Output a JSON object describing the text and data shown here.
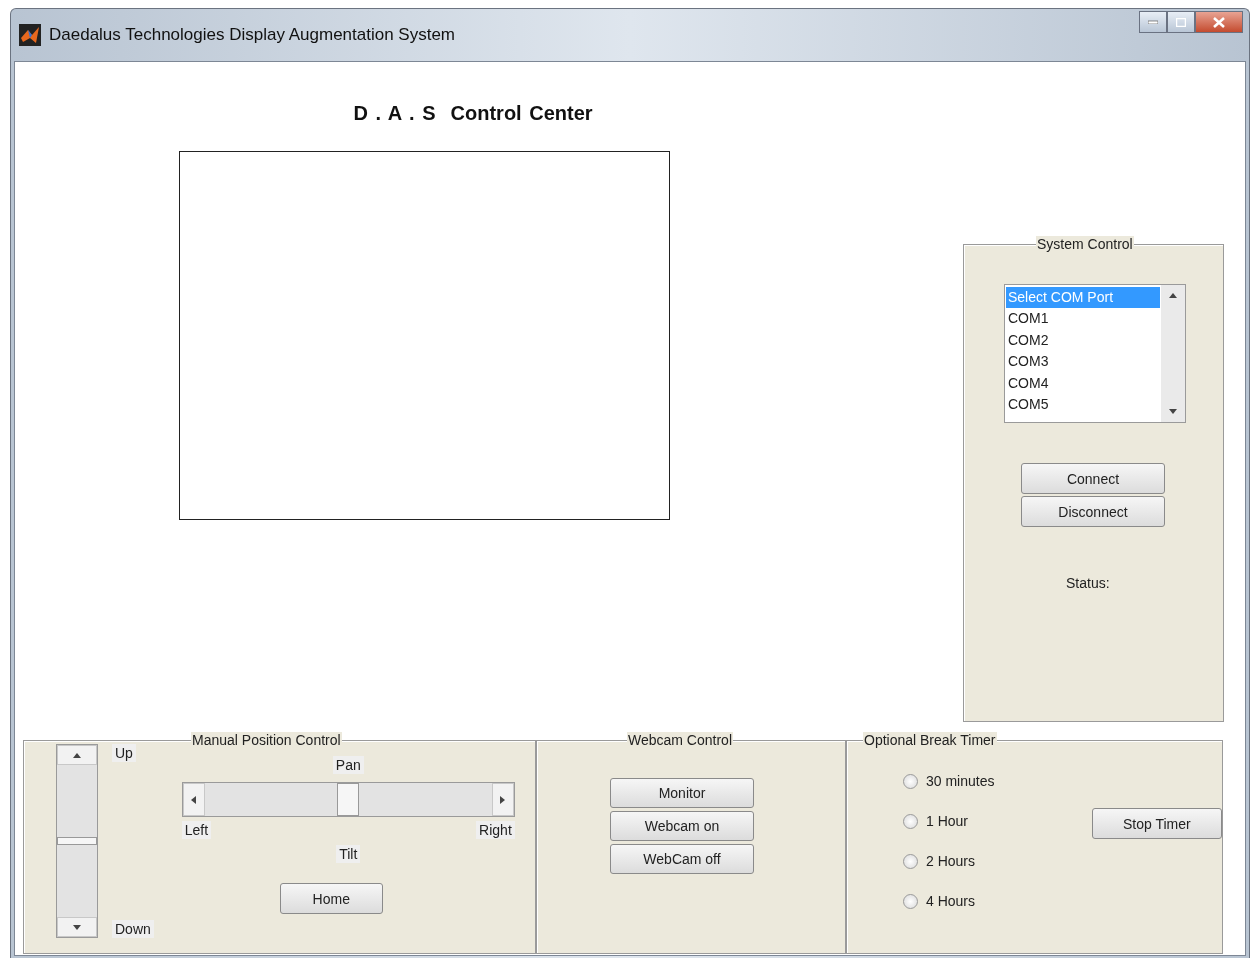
{
  "window": {
    "title": "Daedalus Technologies Display Augmentation System"
  },
  "heading": "D . A . S  Control Center",
  "system_control": {
    "title": "System Control",
    "ports": [
      {
        "label": "Select COM Port",
        "selected": true
      },
      {
        "label": "COM1",
        "selected": false
      },
      {
        "label": "COM2",
        "selected": false
      },
      {
        "label": "COM3",
        "selected": false
      },
      {
        "label": "COM4",
        "selected": false
      },
      {
        "label": "COM5",
        "selected": false
      }
    ],
    "buttons": [
      "Connect",
      "Disconnect"
    ],
    "status_label": "Status:"
  },
  "manual_position_control": {
    "title": "Manual Position Control",
    "up_label": "Up",
    "down_label": "Down",
    "tilt_slider": {
      "level": 0.5
    },
    "pan_label": "Pan",
    "pan_slider": {
      "level": 0.5
    },
    "left_label": "Left",
    "right_label": "Right",
    "tilt_label": "Tilt",
    "home_button": "Home"
  },
  "webcam_control": {
    "title": "Webcam Control",
    "buttons": [
      "Monitor",
      "Webcam on",
      "WebCam off"
    ]
  },
  "break_timer": {
    "title": "Optional Break Timer",
    "options": [
      {
        "label": "30 minutes",
        "selected": false
      },
      {
        "label": "1 Hour",
        "selected": false
      },
      {
        "label": "2 Hours",
        "selected": false
      },
      {
        "label": "4 Hours",
        "selected": false
      }
    ],
    "stop_button": "Stop Timer"
  }
}
